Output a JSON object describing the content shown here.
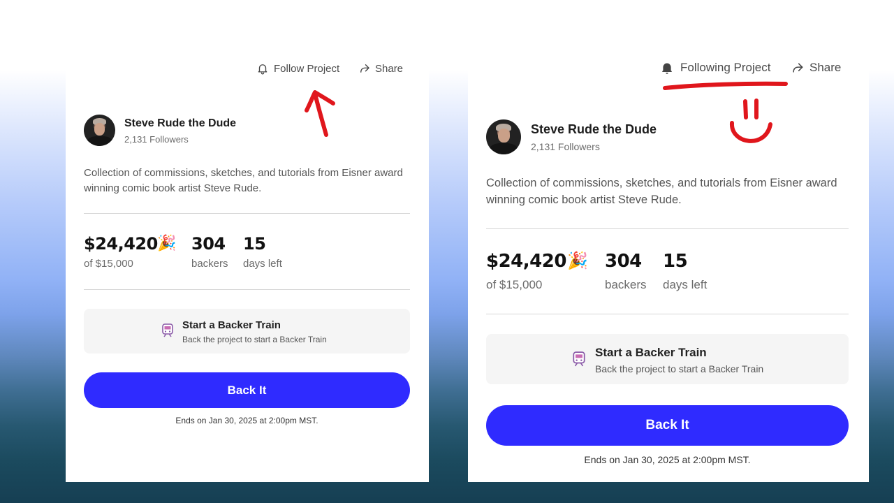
{
  "left_card": {
    "follow_label": "Follow Project",
    "share_label": "Share",
    "creator_name": "Steve Rude the Dude",
    "followers": "2,131 Followers",
    "description": "Collection of commissions, sketches, and tutorials from Eisner award winning comic book artist Steve Rude.",
    "pledged": "$24,420",
    "goal": "of $15,000",
    "backers_count": "304",
    "backers_label": "backers",
    "days_count": "15",
    "days_label": "days left",
    "train_title": "Start a Backer Train",
    "train_subtitle": "Back the project to start a Backer Train",
    "back_button": "Back It",
    "ends_text": "Ends on Jan 30, 2025 at 2:00pm MST."
  },
  "right_card": {
    "follow_label": "Following Project",
    "share_label": "Share",
    "creator_name": "Steve Rude the Dude",
    "followers": "2,131 Followers",
    "description": "Collection of commissions, sketches, and tutorials from Eisner award winning comic book artist Steve Rude.",
    "pledged": "$24,420",
    "goal": "of $15,000",
    "backers_count": "304",
    "backers_label": "backers",
    "days_count": "15",
    "days_label": "days left",
    "train_title": "Start a Backer Train",
    "train_subtitle": "Back the project to start a Backer Train",
    "back_button": "Back It",
    "ends_text": "Ends on Jan 30, 2025 at 2:00pm MST."
  },
  "icons": {
    "follow_left": "bell-outline-icon",
    "follow_right": "bell-filled-icon",
    "share": "share-arrow-icon",
    "celebrate": "party-popper-icon",
    "train": "train-icon"
  },
  "colors": {
    "accent": "#2f2bff",
    "annotation": "#e0161c",
    "card": "#ffffff",
    "backer_train_bg": "#f5f5f5"
  }
}
